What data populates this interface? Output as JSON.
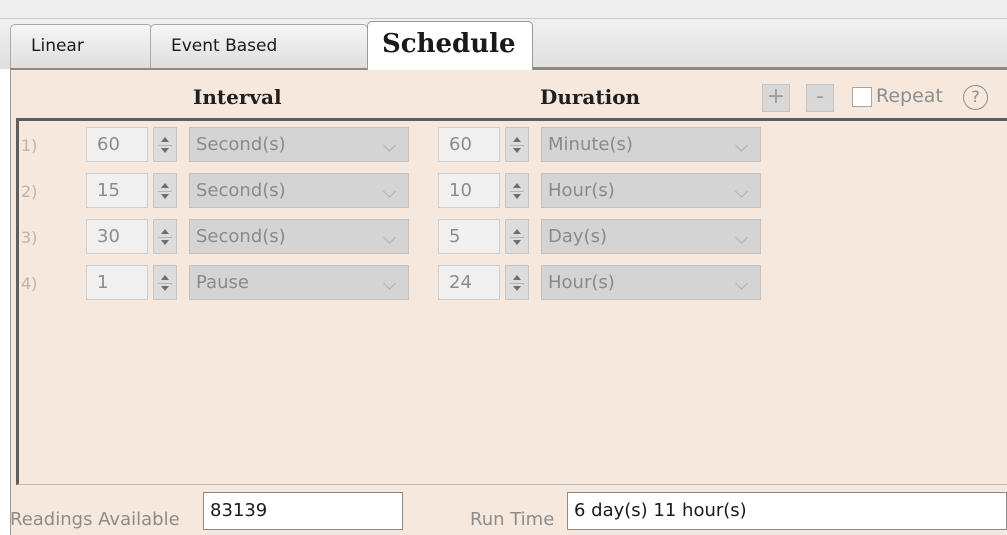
{
  "tabs": [
    {
      "label": "Linear",
      "active": false
    },
    {
      "label": "Event Based",
      "active": false
    },
    {
      "label": "Schedule",
      "active": true
    }
  ],
  "header": {
    "interval_label": "Interval",
    "duration_label": "Duration",
    "add_label": "+",
    "remove_label": "-",
    "repeat_label": "Repeat",
    "repeat_checked": false,
    "help_label": "?"
  },
  "rows": [
    {
      "index": "1)",
      "interval_value": "60",
      "interval_unit": "Second(s)",
      "duration_value": "60",
      "duration_unit": "Minute(s)"
    },
    {
      "index": "2)",
      "interval_value": "15",
      "interval_unit": "Second(s)",
      "duration_value": "10",
      "duration_unit": "Hour(s)"
    },
    {
      "index": "3)",
      "interval_value": "30",
      "interval_unit": "Second(s)",
      "duration_value": "5",
      "duration_unit": "Day(s)"
    },
    {
      "index": "4)",
      "interval_value": "1",
      "interval_unit": "Pause",
      "duration_value": "24",
      "duration_unit": "Hour(s)"
    }
  ],
  "footer": {
    "readings_label": "Readings Available",
    "readings_value": "83139",
    "runtime_label": "Run Time",
    "runtime_value": "6 day(s) 11 hour(s)"
  },
  "icons": {
    "spin_up": "spin-up-arrow-icon",
    "spin_down": "spin-down-arrow-icon",
    "dropdown": "chevron-down-icon",
    "help": "help-circle-icon"
  },
  "colors": {
    "panel_bg": "#f6e8dc",
    "disabled_text": "#8c8c8c",
    "select_bg": "#d4d4d4"
  }
}
